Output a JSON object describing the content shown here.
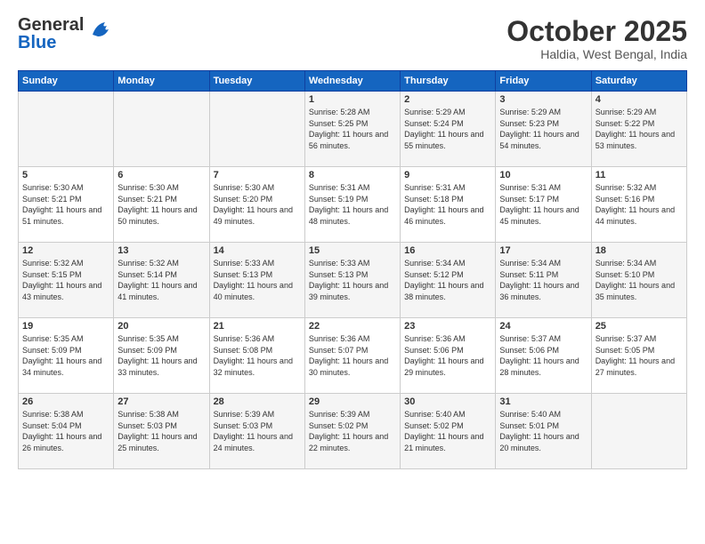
{
  "header": {
    "logo_general": "General",
    "logo_blue": "Blue",
    "month": "October 2025",
    "location": "Haldia, West Bengal, India"
  },
  "weekdays": [
    "Sunday",
    "Monday",
    "Tuesday",
    "Wednesday",
    "Thursday",
    "Friday",
    "Saturday"
  ],
  "weeks": [
    [
      {
        "day": "",
        "sunrise": "",
        "sunset": "",
        "daylight": ""
      },
      {
        "day": "",
        "sunrise": "",
        "sunset": "",
        "daylight": ""
      },
      {
        "day": "",
        "sunrise": "",
        "sunset": "",
        "daylight": ""
      },
      {
        "day": "1",
        "sunrise": "Sunrise: 5:28 AM",
        "sunset": "Sunset: 5:25 PM",
        "daylight": "Daylight: 11 hours and 56 minutes."
      },
      {
        "day": "2",
        "sunrise": "Sunrise: 5:29 AM",
        "sunset": "Sunset: 5:24 PM",
        "daylight": "Daylight: 11 hours and 55 minutes."
      },
      {
        "day": "3",
        "sunrise": "Sunrise: 5:29 AM",
        "sunset": "Sunset: 5:23 PM",
        "daylight": "Daylight: 11 hours and 54 minutes."
      },
      {
        "day": "4",
        "sunrise": "Sunrise: 5:29 AM",
        "sunset": "Sunset: 5:22 PM",
        "daylight": "Daylight: 11 hours and 53 minutes."
      }
    ],
    [
      {
        "day": "5",
        "sunrise": "Sunrise: 5:30 AM",
        "sunset": "Sunset: 5:21 PM",
        "daylight": "Daylight: 11 hours and 51 minutes."
      },
      {
        "day": "6",
        "sunrise": "Sunrise: 5:30 AM",
        "sunset": "Sunset: 5:21 PM",
        "daylight": "Daylight: 11 hours and 50 minutes."
      },
      {
        "day": "7",
        "sunrise": "Sunrise: 5:30 AM",
        "sunset": "Sunset: 5:20 PM",
        "daylight": "Daylight: 11 hours and 49 minutes."
      },
      {
        "day": "8",
        "sunrise": "Sunrise: 5:31 AM",
        "sunset": "Sunset: 5:19 PM",
        "daylight": "Daylight: 11 hours and 48 minutes."
      },
      {
        "day": "9",
        "sunrise": "Sunrise: 5:31 AM",
        "sunset": "Sunset: 5:18 PM",
        "daylight": "Daylight: 11 hours and 46 minutes."
      },
      {
        "day": "10",
        "sunrise": "Sunrise: 5:31 AM",
        "sunset": "Sunset: 5:17 PM",
        "daylight": "Daylight: 11 hours and 45 minutes."
      },
      {
        "day": "11",
        "sunrise": "Sunrise: 5:32 AM",
        "sunset": "Sunset: 5:16 PM",
        "daylight": "Daylight: 11 hours and 44 minutes."
      }
    ],
    [
      {
        "day": "12",
        "sunrise": "Sunrise: 5:32 AM",
        "sunset": "Sunset: 5:15 PM",
        "daylight": "Daylight: 11 hours and 43 minutes."
      },
      {
        "day": "13",
        "sunrise": "Sunrise: 5:32 AM",
        "sunset": "Sunset: 5:14 PM",
        "daylight": "Daylight: 11 hours and 41 minutes."
      },
      {
        "day": "14",
        "sunrise": "Sunrise: 5:33 AM",
        "sunset": "Sunset: 5:13 PM",
        "daylight": "Daylight: 11 hours and 40 minutes."
      },
      {
        "day": "15",
        "sunrise": "Sunrise: 5:33 AM",
        "sunset": "Sunset: 5:13 PM",
        "daylight": "Daylight: 11 hours and 39 minutes."
      },
      {
        "day": "16",
        "sunrise": "Sunrise: 5:34 AM",
        "sunset": "Sunset: 5:12 PM",
        "daylight": "Daylight: 11 hours and 38 minutes."
      },
      {
        "day": "17",
        "sunrise": "Sunrise: 5:34 AM",
        "sunset": "Sunset: 5:11 PM",
        "daylight": "Daylight: 11 hours and 36 minutes."
      },
      {
        "day": "18",
        "sunrise": "Sunrise: 5:34 AM",
        "sunset": "Sunset: 5:10 PM",
        "daylight": "Daylight: 11 hours and 35 minutes."
      }
    ],
    [
      {
        "day": "19",
        "sunrise": "Sunrise: 5:35 AM",
        "sunset": "Sunset: 5:09 PM",
        "daylight": "Daylight: 11 hours and 34 minutes."
      },
      {
        "day": "20",
        "sunrise": "Sunrise: 5:35 AM",
        "sunset": "Sunset: 5:09 PM",
        "daylight": "Daylight: 11 hours and 33 minutes."
      },
      {
        "day": "21",
        "sunrise": "Sunrise: 5:36 AM",
        "sunset": "Sunset: 5:08 PM",
        "daylight": "Daylight: 11 hours and 32 minutes."
      },
      {
        "day": "22",
        "sunrise": "Sunrise: 5:36 AM",
        "sunset": "Sunset: 5:07 PM",
        "daylight": "Daylight: 11 hours and 30 minutes."
      },
      {
        "day": "23",
        "sunrise": "Sunrise: 5:36 AM",
        "sunset": "Sunset: 5:06 PM",
        "daylight": "Daylight: 11 hours and 29 minutes."
      },
      {
        "day": "24",
        "sunrise": "Sunrise: 5:37 AM",
        "sunset": "Sunset: 5:06 PM",
        "daylight": "Daylight: 11 hours and 28 minutes."
      },
      {
        "day": "25",
        "sunrise": "Sunrise: 5:37 AM",
        "sunset": "Sunset: 5:05 PM",
        "daylight": "Daylight: 11 hours and 27 minutes."
      }
    ],
    [
      {
        "day": "26",
        "sunrise": "Sunrise: 5:38 AM",
        "sunset": "Sunset: 5:04 PM",
        "daylight": "Daylight: 11 hours and 26 minutes."
      },
      {
        "day": "27",
        "sunrise": "Sunrise: 5:38 AM",
        "sunset": "Sunset: 5:03 PM",
        "daylight": "Daylight: 11 hours and 25 minutes."
      },
      {
        "day": "28",
        "sunrise": "Sunrise: 5:39 AM",
        "sunset": "Sunset: 5:03 PM",
        "daylight": "Daylight: 11 hours and 24 minutes."
      },
      {
        "day": "29",
        "sunrise": "Sunrise: 5:39 AM",
        "sunset": "Sunset: 5:02 PM",
        "daylight": "Daylight: 11 hours and 22 minutes."
      },
      {
        "day": "30",
        "sunrise": "Sunrise: 5:40 AM",
        "sunset": "Sunset: 5:02 PM",
        "daylight": "Daylight: 11 hours and 21 minutes."
      },
      {
        "day": "31",
        "sunrise": "Sunrise: 5:40 AM",
        "sunset": "Sunset: 5:01 PM",
        "daylight": "Daylight: 11 hours and 20 minutes."
      },
      {
        "day": "",
        "sunrise": "",
        "sunset": "",
        "daylight": ""
      }
    ]
  ]
}
